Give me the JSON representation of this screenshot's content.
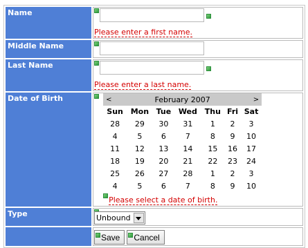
{
  "form": {
    "first_name": {
      "label": "Name",
      "value": "",
      "error": "Please enter a first name."
    },
    "middle_name": {
      "label": "Middle Name",
      "value": ""
    },
    "last_name": {
      "label": "Last Name",
      "value": "",
      "error": "Please enter a last name."
    },
    "dob": {
      "label": "Date of Birth",
      "error": "Please select a date of birth.",
      "calendar": {
        "prev": "<",
        "next": ">",
        "month_label": "February 2007",
        "weekdays": [
          "Sun",
          "Mon",
          "Tue",
          "Wed",
          "Thu",
          "Fri",
          "Sat"
        ],
        "weeks": [
          [
            "28",
            "29",
            "30",
            "31",
            "1",
            "2",
            "3"
          ],
          [
            "4",
            "5",
            "6",
            "7",
            "8",
            "9",
            "10"
          ],
          [
            "11",
            "12",
            "13",
            "14",
            "15",
            "16",
            "17"
          ],
          [
            "18",
            "19",
            "20",
            "21",
            "22",
            "23",
            "24"
          ],
          [
            "25",
            "26",
            "27",
            "28",
            "1",
            "2",
            "3"
          ],
          [
            "4",
            "5",
            "6",
            "7",
            "8",
            "9",
            "10"
          ]
        ]
      }
    },
    "type": {
      "label": "Type",
      "selected": "Unbound"
    },
    "buttons": {
      "save": "Save",
      "cancel": "Cancel"
    }
  },
  "colors": {
    "label_bg": "#4f7fd6",
    "error": "#d40000",
    "calendar_header_bg": "#c9c9c9",
    "marker_green": "#2f9a3c"
  },
  "icons": {
    "field_marker": "green-square-marker-icon",
    "select_arrow": "chevron-down-icon"
  }
}
